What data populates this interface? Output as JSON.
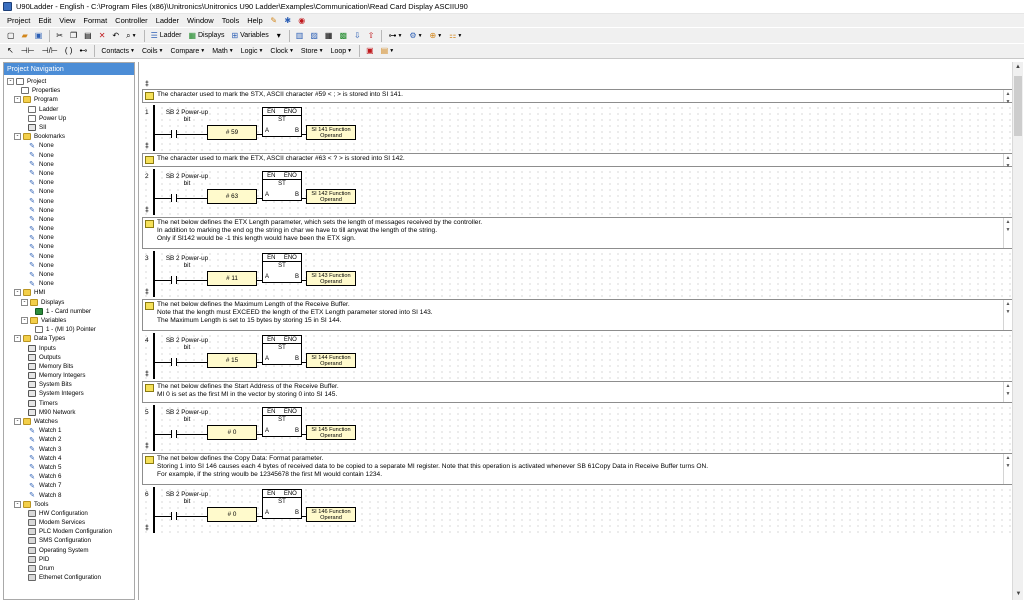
{
  "window": {
    "title": "U90Ladder - English - C:\\Program Files (x86)\\Unitronics\\Unitronics U90 Ladder\\Examples\\Communication\\Read Card  Display  ASCIIU90"
  },
  "menu": [
    "Project",
    "Edit",
    "View",
    "Format",
    "Controller",
    "Ladder",
    "Window",
    "Tools",
    "Help"
  ],
  "toolbar1": {
    "ladder": "Ladder",
    "displays": "Displays",
    "variables": "Variables"
  },
  "toolbar2": {
    "contacts": "Contacts",
    "coils": "Coils",
    "compare": "Compare",
    "math": "Math",
    "logic": "Logic",
    "clock": "Clock",
    "store": "Store",
    "loop": "Loop"
  },
  "nav": {
    "header": "Project Navigation",
    "tree": [
      {
        "label": "Project",
        "level": 0,
        "icon": "doc",
        "exp": "-"
      },
      {
        "label": "Properties",
        "level": 2,
        "icon": "doc"
      },
      {
        "label": "Program",
        "level": 1,
        "icon": "folder",
        "exp": "-"
      },
      {
        "label": "Ladder",
        "level": 3,
        "icon": "doc"
      },
      {
        "label": "Power Up",
        "level": 3,
        "icon": "doc"
      },
      {
        "label": "SII",
        "level": 3,
        "icon": "key"
      },
      {
        "label": "Bookmarks",
        "level": 1,
        "icon": "folder",
        "exp": "-"
      },
      {
        "label": "None",
        "level": 3,
        "icon": "bookmark"
      },
      {
        "label": "None",
        "level": 3,
        "icon": "bookmark"
      },
      {
        "label": "None",
        "level": 3,
        "icon": "bookmark"
      },
      {
        "label": "None",
        "level": 3,
        "icon": "bookmark"
      },
      {
        "label": "None",
        "level": 3,
        "icon": "bookmark"
      },
      {
        "label": "None",
        "level": 3,
        "icon": "bookmark"
      },
      {
        "label": "None",
        "level": 3,
        "icon": "bookmark"
      },
      {
        "label": "None",
        "level": 3,
        "icon": "bookmark"
      },
      {
        "label": "None",
        "level": 3,
        "icon": "bookmark"
      },
      {
        "label": "None",
        "level": 3,
        "icon": "bookmark"
      },
      {
        "label": "None",
        "level": 3,
        "icon": "bookmark"
      },
      {
        "label": "None",
        "level": 3,
        "icon": "bookmark"
      },
      {
        "label": "None",
        "level": 3,
        "icon": "bookmark"
      },
      {
        "label": "None",
        "level": 3,
        "icon": "bookmark"
      },
      {
        "label": "None",
        "level": 3,
        "icon": "bookmark"
      },
      {
        "label": "None",
        "level": 3,
        "icon": "bookmark"
      },
      {
        "label": "HMI",
        "level": 1,
        "icon": "folder",
        "exp": "-"
      },
      {
        "label": "Displays",
        "level": 2,
        "icon": "folder",
        "exp": "-"
      },
      {
        "label": "1 - Card number",
        "level": 4,
        "icon": "screen"
      },
      {
        "label": "Variables",
        "level": 2,
        "icon": "folder",
        "exp": "-"
      },
      {
        "label": "1 - (MI 10)  Pointer",
        "level": 4,
        "icon": "doc"
      },
      {
        "label": "Data Types",
        "level": 1,
        "icon": "folder",
        "exp": "-"
      },
      {
        "label": "Inputs",
        "level": 3,
        "icon": "key"
      },
      {
        "label": "Outputs",
        "level": 3,
        "icon": "key"
      },
      {
        "label": "Memory Bits",
        "level": 3,
        "icon": "key"
      },
      {
        "label": "Memory Integers",
        "level": 3,
        "icon": "key"
      },
      {
        "label": "System Bits",
        "level": 3,
        "icon": "key"
      },
      {
        "label": "System Integers",
        "level": 3,
        "icon": "key"
      },
      {
        "label": "Timers",
        "level": 3,
        "icon": "key"
      },
      {
        "label": "M90 Network",
        "level": 3,
        "icon": "key"
      },
      {
        "label": "Watches",
        "level": 1,
        "icon": "folder",
        "exp": "-"
      },
      {
        "label": "Watch 1",
        "level": 3,
        "icon": "watch"
      },
      {
        "label": "Watch 2",
        "level": 3,
        "icon": "watch"
      },
      {
        "label": "Watch 3",
        "level": 3,
        "icon": "watch"
      },
      {
        "label": "Watch 4",
        "level": 3,
        "icon": "watch"
      },
      {
        "label": "Watch 5",
        "level": 3,
        "icon": "watch"
      },
      {
        "label": "Watch 6",
        "level": 3,
        "icon": "watch"
      },
      {
        "label": "Watch 7",
        "level": 3,
        "icon": "watch"
      },
      {
        "label": "Watch 8",
        "level": 3,
        "icon": "watch"
      },
      {
        "label": "Tools",
        "level": 1,
        "icon": "folder",
        "exp": "-"
      },
      {
        "label": "HW Configuration",
        "level": 3,
        "icon": "tool"
      },
      {
        "label": "Modem Services",
        "level": 3,
        "icon": "tool"
      },
      {
        "label": "PLC Modem Configuration",
        "level": 3,
        "icon": "tool"
      },
      {
        "label": "SMS Configuration",
        "level": 3,
        "icon": "tool"
      },
      {
        "label": "Operating System",
        "level": 3,
        "icon": "tool"
      },
      {
        "label": "PID",
        "level": 3,
        "icon": "tool"
      },
      {
        "label": "Drum",
        "level": 3,
        "icon": "tool"
      },
      {
        "label": "Ethernet Configuration",
        "level": 3,
        "icon": "tool"
      }
    ]
  },
  "ladder": {
    "contact": "SB 2  Power-up\nbit",
    "fb_en": "EN",
    "fb_eno": "ENO",
    "fb_name": "ST",
    "fb_a": "A",
    "fb_b": "B",
    "nets": [
      {
        "comment": "The character used to mark the STX, ASCII character #59 < ; > is stored into SI 141.",
        "num": "1",
        "constant": "# 59",
        "operand": "SI 141 Function\nOperand"
      },
      {
        "comment": "The character used to mark the ETX, ASCII character #63 < ? > is stored into SI 142.",
        "num": "2",
        "constant": "# 63",
        "operand": "SI 142 Function\nOperand"
      },
      {
        "comment": "The net below defines the ETX Length parameter, which sets the length of messages received by the controller.\nIn addition to marking the end og the string in char we have to till anywat the length of the string.\nOnly if SI142 would be -1 this length would have been the ETX sign.",
        "num": "3",
        "constant": "# 11",
        "operand": "SI 143 Function\nOperand"
      },
      {
        "comment": "The net below defines the Maximum Length of the Receive Buffer.\nNote that the length must EXCEED the length of the ETX Length parameter stored into SI 143.\nThe Maximum Length is set to 15 bytes by storing 15 in SI 144.",
        "num": "4",
        "constant": "# 15",
        "operand": "SI 144 Function\nOperand"
      },
      {
        "comment": "The net below defines the Start Address of the Receive Buffer.\nMI 0 is set as the first MI in the vector by storing 0 into SI 145.",
        "num": "5",
        "constant": "# 0",
        "operand": "SI 145 Function\nOperand"
      },
      {
        "comment": "The net below defines the Copy Data: Format parameter.\nStoring  1 into SI 146 causes each 4 bytes of received data to be copied to a separate MI register. Note that this operation is activated whenever SB 61Copy Data in Receive Buffer turns ON.\nFor example, if the string woulb be 12345678 the first MI would contain 1234.",
        "num": "6",
        "constant": "# 0",
        "operand": "SI 146 Function\nOperand"
      }
    ]
  }
}
